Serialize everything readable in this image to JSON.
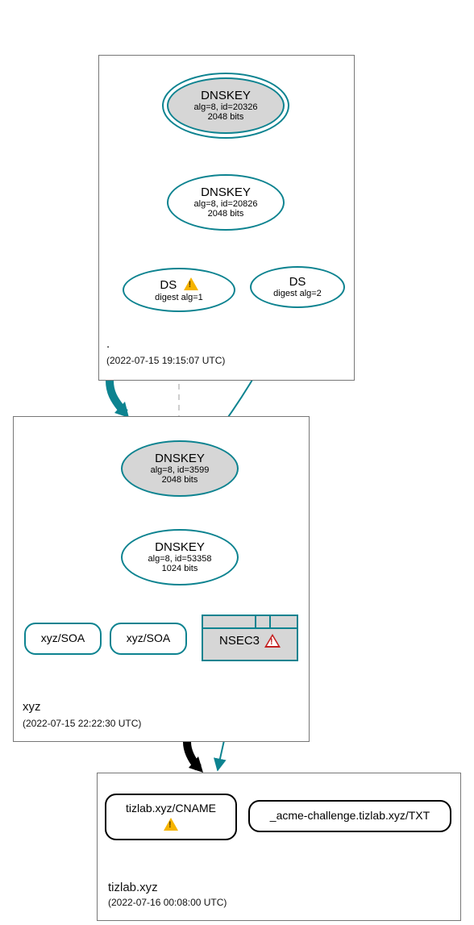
{
  "zones": {
    "root": {
      "label": ".",
      "timestamp": "(2022-07-15 19:15:07 UTC)"
    },
    "xyz": {
      "label": "xyz",
      "timestamp": "(2022-07-15 22:22:30 UTC)"
    },
    "tizlab": {
      "label": "tizlab.xyz",
      "timestamp": "(2022-07-16 00:08:00 UTC)"
    }
  },
  "nodes": {
    "root_ksk": {
      "title": "DNSKEY",
      "line2": "alg=8, id=20326",
      "line3": "2048 bits"
    },
    "root_zsk": {
      "title": "DNSKEY",
      "line2": "alg=8, id=20826",
      "line3": "2048 bits"
    },
    "ds1": {
      "title": "DS",
      "line2": "digest alg=1"
    },
    "ds2": {
      "title": "DS",
      "line2": "digest alg=2"
    },
    "xyz_ksk": {
      "title": "DNSKEY",
      "line2": "alg=8, id=3599",
      "line3": "2048 bits"
    },
    "xyz_zsk": {
      "title": "DNSKEY",
      "line2": "alg=8, id=53358",
      "line3": "1024 bits"
    },
    "xyz_soa1": {
      "title": "xyz/SOA"
    },
    "xyz_soa2": {
      "title": "xyz/SOA"
    },
    "nsec3": {
      "title": "NSEC3"
    },
    "cname": {
      "title": "tizlab.xyz/CNAME"
    },
    "txt": {
      "title": "_acme-challenge.tizlab.xyz/TXT"
    }
  }
}
